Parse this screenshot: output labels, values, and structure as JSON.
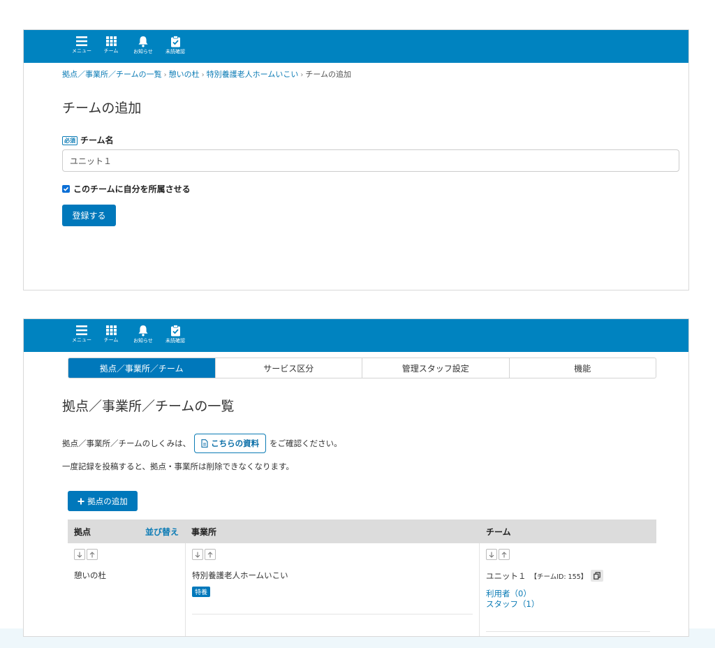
{
  "nav": [
    {
      "icon": "menu-icon",
      "label": "メニュー"
    },
    {
      "icon": "grid-icon",
      "label": "チーム"
    },
    {
      "icon": "bell-icon",
      "label": "お知らせ"
    },
    {
      "icon": "clipboard-check-icon",
      "label": "未読確認"
    }
  ],
  "form_page": {
    "breadcrumb": [
      "拠点／事業所／チームの一覧",
      "憩いの杜",
      "特別養護老人ホームいこい",
      "チームの追加"
    ],
    "title": "チームの追加",
    "required_badge": "必須",
    "field_label": "チーム名",
    "team_name_value": "ユニット１",
    "checkbox_label": "このチームに自分を所属させる",
    "checkbox_checked": true,
    "submit_label": "登録する"
  },
  "list_page": {
    "tabs": [
      {
        "label": "拠点／事業所／チーム",
        "active": true
      },
      {
        "label": "サービス区分",
        "active": false
      },
      {
        "label": "管理スタッフ設定",
        "active": false
      },
      {
        "label": "機能",
        "active": false
      }
    ],
    "title": "拠点／事業所／チームの一覧",
    "info_prefix": "拠点／事業所／チームのしくみは、",
    "info_button": "こちらの資料",
    "info_suffix": "をご確認ください。",
    "notice": "一度記録を投稿すると、拠点・事業所は削除できなくなります。",
    "add_base_label": "拠点の追加",
    "table": {
      "headers": {
        "base": "拠点",
        "sort": "並び替え",
        "office": "事業所",
        "team": "チーム"
      },
      "row": {
        "base": "憩いの杜",
        "office": "特別養護老人ホームいこい",
        "office_tag": "特養",
        "team_name": "ユニット１",
        "team_id": "【チームID: 155】",
        "users_link": "利用者（0）",
        "staff_link": "スタッフ（1）"
      }
    }
  },
  "colors": {
    "primary": "#0078bb",
    "topbar": "#0083c0",
    "link": "#0b7bb5"
  }
}
